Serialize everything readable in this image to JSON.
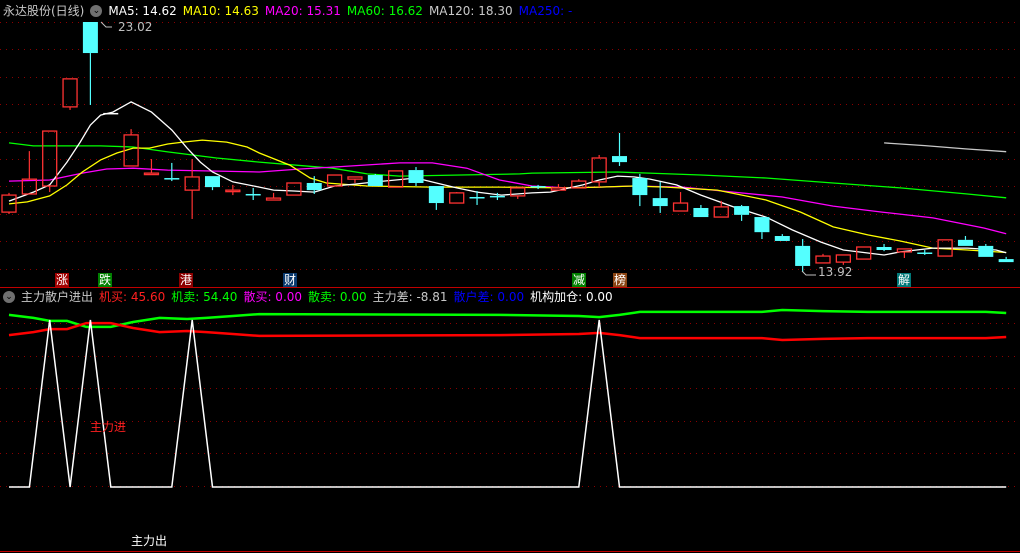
{
  "header": {
    "title": "永达股份(日线)",
    "ma": [
      {
        "label": "MA5: 14.62",
        "color": "#ffffff"
      },
      {
        "label": "MA10: 14.63",
        "color": "#ffff00"
      },
      {
        "label": "MA20: 15.31",
        "color": "#ff00ff"
      },
      {
        "label": "MA60: 16.62",
        "color": "#00ff00"
      },
      {
        "label": "MA120: 18.30",
        "color": "#c8c8c8"
      },
      {
        "label": "MA250: -",
        "color": "#0000ff"
      }
    ]
  },
  "annotations": {
    "high": "23.02",
    "low": "13.92"
  },
  "signals": [
    {
      "text": "涨",
      "color": "#a00000"
    },
    {
      "text": "跌",
      "color": "#008000"
    },
    {
      "text": "港",
      "color": "#8b0000"
    },
    {
      "text": "财",
      "color": "#0a3a6e"
    },
    {
      "text": "减",
      "color": "#008000"
    },
    {
      "text": "榜",
      "color": "#8b4513"
    },
    {
      "text": "解",
      "color": "#007878"
    }
  ],
  "sub_header": {
    "title": "主力散户进出",
    "items": [
      {
        "label": "机买: 45.60",
        "color": "#ff2020"
      },
      {
        "label": "机卖: 54.40",
        "color": "#00ff00"
      },
      {
        "label": "散买: 0.00",
        "color": "#ff00ff"
      },
      {
        "label": "散卖: 0.00",
        "color": "#00ff00"
      },
      {
        "label": "主力差: -8.81",
        "color": "#c8c8c8"
      },
      {
        "label": "散户差: 0.00",
        "color": "#0000ff"
      },
      {
        "label": "机构加仓: 0.00",
        "color": "#ffffff"
      }
    ]
  },
  "sub_labels": {
    "in": "主力进",
    "out": "主力出"
  },
  "colors": {
    "up": "#ff3232",
    "down": "#54ffff",
    "grid": "#8b0000",
    "ma5": "#ffffff",
    "ma10": "#ffff00",
    "ma20": "#ff00ff",
    "ma60": "#00ff00",
    "ma120": "#c8c8c8",
    "buy": "#ff0000",
    "sell": "#00ff00"
  },
  "chart_data": [
    {
      "type": "candlestick",
      "title": "永达股份(日线)",
      "ylim": [
        13.92,
        23.02
      ],
      "grid": true,
      "ohlc": [
        [
          16.1,
          16.8,
          16.03,
          16.72
        ],
        [
          16.76,
          18.32,
          16.76,
          17.3
        ],
        [
          17.05,
          19.05,
          16.83,
          19.05
        ],
        [
          19.93,
          20.95,
          19.82,
          20.95
        ],
        [
          23.02,
          23.02,
          20.0,
          21.89
        ],
        [
          19.71,
          19.71,
          19.71,
          19.71
        ],
        [
          17.78,
          19.12,
          17.78,
          18.91
        ],
        [
          17.49,
          18.03,
          17.49,
          17.52
        ],
        [
          17.34,
          17.89,
          17.23,
          17.3
        ],
        [
          16.9,
          18.03,
          15.85,
          17.38
        ],
        [
          17.41,
          17.41,
          16.9,
          17.01
        ],
        [
          16.87,
          17.09,
          16.72,
          16.9
        ],
        [
          16.76,
          16.98,
          16.54,
          16.72
        ],
        [
          16.54,
          16.8,
          16.54,
          16.61
        ],
        [
          16.72,
          17.16,
          16.72,
          17.16
        ],
        [
          17.16,
          17.41,
          16.76,
          16.9
        ],
        [
          17.05,
          17.45,
          17.05,
          17.45
        ],
        [
          17.3,
          17.38,
          17.16,
          17.38
        ],
        [
          17.45,
          17.49,
          17.05,
          17.05
        ],
        [
          17.01,
          17.6,
          17.01,
          17.6
        ],
        [
          17.63,
          17.74,
          17.05,
          17.16
        ],
        [
          17.05,
          17.05,
          16.18,
          16.43
        ],
        [
          16.43,
          16.83,
          16.43,
          16.8
        ],
        [
          16.65,
          16.87,
          16.36,
          16.61
        ],
        [
          16.69,
          16.8,
          16.54,
          16.65
        ],
        [
          16.69,
          16.98,
          16.58,
          16.98
        ],
        [
          17.05,
          17.09,
          16.94,
          17.01
        ],
        [
          16.9,
          17.12,
          16.9,
          16.98
        ],
        [
          16.98,
          17.3,
          16.98,
          17.23
        ],
        [
          17.2,
          18.18,
          17.01,
          18.07
        ],
        [
          18.14,
          18.98,
          17.78,
          17.92
        ],
        [
          17.34,
          17.49,
          16.32,
          16.72
        ],
        [
          16.61,
          17.2,
          16.07,
          16.32
        ],
        [
          16.14,
          16.83,
          16.14,
          16.43
        ],
        [
          16.25,
          16.36,
          15.92,
          15.92
        ],
        [
          15.92,
          16.51,
          15.92,
          16.29
        ],
        [
          16.32,
          16.36,
          15.78,
          16.0
        ],
        [
          15.92,
          15.92,
          15.12,
          15.37
        ],
        [
          15.23,
          15.3,
          15.05,
          15.05
        ],
        [
          14.87,
          15.12,
          13.92,
          14.14
        ],
        [
          14.25,
          14.58,
          14.25,
          14.5
        ],
        [
          14.28,
          14.54,
          14.18,
          14.54
        ],
        [
          14.39,
          14.83,
          14.39,
          14.83
        ],
        [
          14.83,
          14.94,
          14.68,
          14.72
        ],
        [
          14.65,
          14.76,
          14.43,
          14.76
        ],
        [
          14.63,
          14.72,
          14.54,
          14.61
        ],
        [
          14.5,
          15.09,
          14.5,
          15.09
        ],
        [
          15.09,
          15.23,
          14.87,
          14.87
        ],
        [
          14.87,
          14.94,
          14.47,
          14.47
        ],
        [
          14.39,
          14.47,
          14.28,
          14.28
        ]
      ],
      "ma_series": {
        "ma5": [
          [
            0,
            16.5
          ],
          [
            1.2,
            16.83
          ],
          [
            2,
            17.09
          ],
          [
            2.85,
            17.92
          ],
          [
            3.5,
            18.65
          ],
          [
            4,
            19.27
          ],
          [
            4.5,
            19.63
          ],
          [
            5.1,
            19.74
          ],
          [
            6,
            20.11
          ],
          [
            7,
            19.74
          ],
          [
            8,
            19.09
          ],
          [
            8.75,
            18.43
          ],
          [
            9.4,
            17.92
          ],
          [
            10,
            17.56
          ],
          [
            11,
            17.2
          ],
          [
            12.3,
            17.01
          ],
          [
            13,
            16.9
          ],
          [
            14,
            16.87
          ],
          [
            15,
            16.83
          ],
          [
            16,
            17.05
          ],
          [
            17,
            17.12
          ],
          [
            18,
            17.2
          ],
          [
            19,
            17.27
          ],
          [
            20,
            17.34
          ],
          [
            21,
            17.16
          ],
          [
            22,
            16.98
          ],
          [
            23,
            16.83
          ],
          [
            24.2,
            16.72
          ],
          [
            25.7,
            16.8
          ],
          [
            26.6,
            16.83
          ],
          [
            28.2,
            17.09
          ],
          [
            29,
            17.27
          ],
          [
            29.9,
            17.41
          ],
          [
            30.7,
            17.38
          ],
          [
            31.5,
            17.3
          ],
          [
            32.8,
            17.09
          ],
          [
            34,
            16.72
          ],
          [
            35.6,
            16.29
          ],
          [
            37.2,
            15.92
          ],
          [
            38.5,
            15.45
          ],
          [
            39.9,
            15.01
          ],
          [
            41,
            14.72
          ],
          [
            42.2,
            14.61
          ],
          [
            43,
            14.54
          ],
          [
            43.8,
            14.65
          ],
          [
            45.4,
            14.79
          ],
          [
            47.1,
            14.79
          ],
          [
            48.5,
            14.72
          ],
          [
            49,
            14.62
          ]
        ],
        "ma10": [
          [
            0,
            16.4
          ],
          [
            0.9,
            16.47
          ],
          [
            2,
            16.69
          ],
          [
            2.85,
            17.09
          ],
          [
            3.6,
            17.56
          ],
          [
            4.5,
            18.0
          ],
          [
            5.3,
            18.25
          ],
          [
            6.1,
            18.43
          ],
          [
            6.9,
            18.43
          ],
          [
            7.8,
            18.58
          ],
          [
            8.55,
            18.65
          ],
          [
            9.5,
            18.72
          ],
          [
            10.7,
            18.65
          ],
          [
            11.7,
            18.47
          ],
          [
            12.3,
            18.25
          ],
          [
            13.8,
            17.81
          ],
          [
            14.8,
            17.34
          ],
          [
            15.6,
            17.16
          ],
          [
            17.6,
            17.05
          ],
          [
            20.8,
            17.01
          ],
          [
            24.1,
            17.01
          ],
          [
            27.4,
            16.98
          ],
          [
            29,
            17.01
          ],
          [
            30.7,
            17.05
          ],
          [
            32.3,
            17.01
          ],
          [
            34.8,
            16.9
          ],
          [
            37.2,
            16.54
          ],
          [
            38.9,
            16.1
          ],
          [
            40.5,
            15.56
          ],
          [
            42.2,
            15.27
          ],
          [
            43.8,
            15.05
          ],
          [
            45.4,
            14.79
          ],
          [
            47.1,
            14.72
          ],
          [
            49,
            14.63
          ]
        ],
        "ma20": [
          [
            0,
            17.23
          ],
          [
            2,
            17.27
          ],
          [
            3.6,
            17.52
          ],
          [
            4.8,
            17.67
          ],
          [
            6.1,
            17.7
          ],
          [
            7.8,
            17.63
          ],
          [
            12.3,
            17.56
          ],
          [
            14.3,
            17.67
          ],
          [
            15.9,
            17.74
          ],
          [
            19.2,
            17.89
          ],
          [
            20.8,
            17.89
          ],
          [
            22.5,
            17.7
          ],
          [
            24.1,
            17.27
          ],
          [
            25.7,
            17.05
          ],
          [
            27.4,
            16.98
          ],
          [
            29,
            17.01
          ],
          [
            30.7,
            17.05
          ],
          [
            33.1,
            17.01
          ],
          [
            35.6,
            16.83
          ],
          [
            38,
            16.65
          ],
          [
            40.5,
            16.32
          ],
          [
            42.9,
            16.1
          ],
          [
            45.4,
            15.89
          ],
          [
            47.9,
            15.52
          ],
          [
            49,
            15.31
          ]
        ],
        "ma60": [
          [
            0,
            18.62
          ],
          [
            1.2,
            18.51
          ],
          [
            4.5,
            18.51
          ],
          [
            6.1,
            18.47
          ],
          [
            7.8,
            18.29
          ],
          [
            10.2,
            18.07
          ],
          [
            12.3,
            17.92
          ],
          [
            15.9,
            17.7
          ],
          [
            17.6,
            17.49
          ],
          [
            19.2,
            17.41
          ],
          [
            25.1,
            17.49
          ],
          [
            25.7,
            17.52
          ],
          [
            29.9,
            17.56
          ],
          [
            34,
            17.45
          ],
          [
            37.2,
            17.34
          ],
          [
            40.5,
            17.16
          ],
          [
            43.8,
            16.98
          ],
          [
            47.1,
            16.76
          ],
          [
            49,
            16.62
          ]
        ],
        "ma120": [
          [
            43,
            18.62
          ],
          [
            45,
            18.52
          ],
          [
            47,
            18.4
          ],
          [
            49,
            18.3
          ]
        ]
      },
      "signal_markers": [
        {
          "label": "涨",
          "index": 2.6
        },
        {
          "label": "跌",
          "index": 4.7
        },
        {
          "label": "港",
          "index": 8.7
        },
        {
          "label": "财",
          "index": 13.8
        },
        {
          "label": "减",
          "index": 28
        },
        {
          "label": "榜",
          "index": 30
        },
        {
          "label": "解",
          "index": 44
        }
      ]
    },
    {
      "type": "line",
      "title": "主力散户进出",
      "series": [
        {
          "name": "机买",
          "points": [
            [
              0,
              46.3
            ],
            [
              1.2,
              47.4
            ],
            [
              2,
              48.5
            ],
            [
              2.85,
              48.5
            ],
            [
              3.8,
              50.7
            ],
            [
              5,
              50.7
            ],
            [
              6.1,
              48.9
            ],
            [
              7.4,
              47.4
            ],
            [
              8.75,
              47.8
            ],
            [
              9.7,
              47.4
            ],
            [
              11,
              46.7
            ],
            [
              12.3,
              46.0
            ],
            [
              24.1,
              46.3
            ],
            [
              28,
              46.7
            ],
            [
              29,
              47.1
            ],
            [
              30,
              46.3
            ],
            [
              31,
              45.2
            ],
            [
              37,
              45.2
            ],
            [
              38,
              44.5
            ],
            [
              40,
              44.9
            ],
            [
              42.2,
              45.2
            ],
            [
              48,
              45.2
            ],
            [
              49,
              45.6
            ]
          ]
        },
        {
          "name": "机卖",
          "derived": "100 - 机买"
        }
      ],
      "main_force_signal_indices": [
        2,
        4,
        9,
        29
      ]
    }
  ]
}
